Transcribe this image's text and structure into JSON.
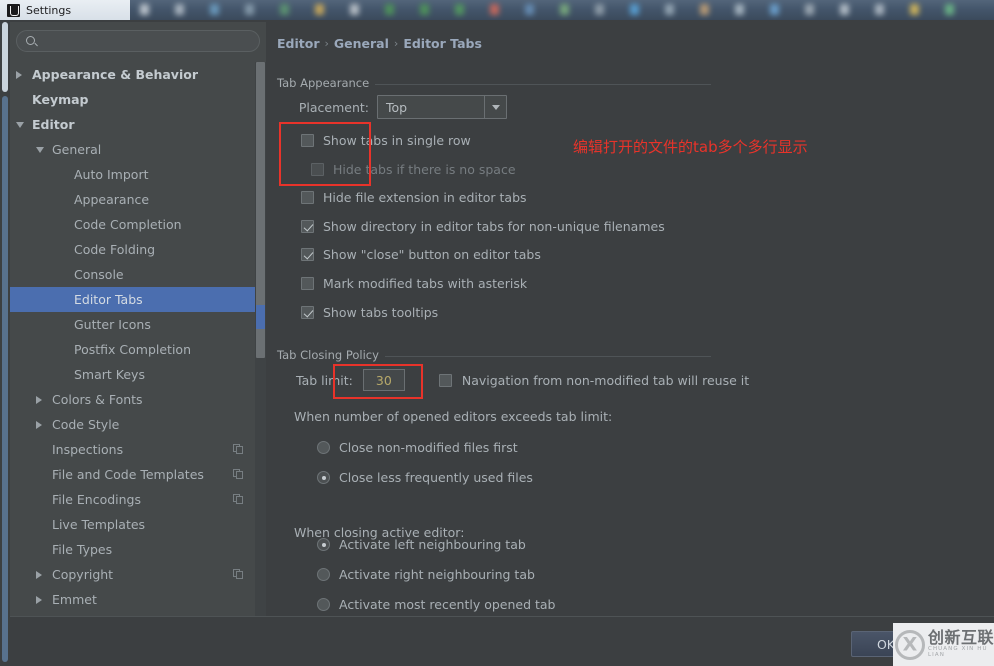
{
  "window": {
    "title": "Settings",
    "logo_icon": "intellij-idea-logo-icon"
  },
  "search": {
    "placeholder": "",
    "value": "",
    "icon": "search-icon"
  },
  "sidebar": {
    "items": [
      {
        "label": "Appearance & Behavior",
        "indent": 0,
        "arrow": "closed",
        "bold": true,
        "selected": false,
        "copy": false
      },
      {
        "label": "Keymap",
        "indent": 0,
        "arrow": "none",
        "bold": true,
        "selected": false,
        "copy": false
      },
      {
        "label": "Editor",
        "indent": 0,
        "arrow": "open",
        "bold": true,
        "selected": false,
        "copy": false
      },
      {
        "label": "General",
        "indent": 1,
        "arrow": "open",
        "bold": false,
        "selected": false,
        "copy": false
      },
      {
        "label": "Auto Import",
        "indent": 2,
        "arrow": "none",
        "bold": false,
        "selected": false,
        "copy": false
      },
      {
        "label": "Appearance",
        "indent": 2,
        "arrow": "none",
        "bold": false,
        "selected": false,
        "copy": false
      },
      {
        "label": "Code Completion",
        "indent": 2,
        "arrow": "none",
        "bold": false,
        "selected": false,
        "copy": false
      },
      {
        "label": "Code Folding",
        "indent": 2,
        "arrow": "none",
        "bold": false,
        "selected": false,
        "copy": false
      },
      {
        "label": "Console",
        "indent": 2,
        "arrow": "none",
        "bold": false,
        "selected": false,
        "copy": false
      },
      {
        "label": "Editor Tabs",
        "indent": 2,
        "arrow": "none",
        "bold": false,
        "selected": true,
        "copy": false
      },
      {
        "label": "Gutter Icons",
        "indent": 2,
        "arrow": "none",
        "bold": false,
        "selected": false,
        "copy": false
      },
      {
        "label": "Postfix Completion",
        "indent": 2,
        "arrow": "none",
        "bold": false,
        "selected": false,
        "copy": false
      },
      {
        "label": "Smart Keys",
        "indent": 2,
        "arrow": "none",
        "bold": false,
        "selected": false,
        "copy": false
      },
      {
        "label": "Colors & Fonts",
        "indent": 1,
        "arrow": "closed",
        "bold": false,
        "selected": false,
        "copy": false
      },
      {
        "label": "Code Style",
        "indent": 1,
        "arrow": "closed",
        "bold": false,
        "selected": false,
        "copy": false
      },
      {
        "label": "Inspections",
        "indent": 1,
        "arrow": "none",
        "bold": false,
        "selected": false,
        "copy": true
      },
      {
        "label": "File and Code Templates",
        "indent": 1,
        "arrow": "none",
        "bold": false,
        "selected": false,
        "copy": true
      },
      {
        "label": "File Encodings",
        "indent": 1,
        "arrow": "none",
        "bold": false,
        "selected": false,
        "copy": true
      },
      {
        "label": "Live Templates",
        "indent": 1,
        "arrow": "none",
        "bold": false,
        "selected": false,
        "copy": false
      },
      {
        "label": "File Types",
        "indent": 1,
        "arrow": "none",
        "bold": false,
        "selected": false,
        "copy": false
      },
      {
        "label": "Copyright",
        "indent": 1,
        "arrow": "closed",
        "bold": false,
        "selected": false,
        "copy": true
      },
      {
        "label": "Emmet",
        "indent": 1,
        "arrow": "closed",
        "bold": false,
        "selected": false,
        "copy": false
      }
    ]
  },
  "breadcrumb": {
    "parts": [
      "Editor",
      "General",
      "Editor Tabs"
    ],
    "separator": "›"
  },
  "tab_appearance": {
    "group_title": "Tab Appearance",
    "placement_label": "Placement:",
    "placement_value": "Top",
    "checkboxes": [
      {
        "label": "Show tabs in single row",
        "checked": false,
        "dimmed": false
      },
      {
        "label": "Hide tabs if there is no space",
        "checked": false,
        "dimmed": true
      },
      {
        "label": "Hide file extension in editor tabs",
        "checked": false,
        "dimmed": false
      },
      {
        "label": "Show directory in editor tabs for non-unique filenames",
        "checked": true,
        "dimmed": false
      },
      {
        "label": "Show \"close\" button on editor tabs",
        "checked": true,
        "dimmed": false
      },
      {
        "label": "Mark modified tabs with asterisk",
        "checked": false,
        "dimmed": false
      },
      {
        "label": "Show tabs tooltips",
        "checked": true,
        "dimmed": false
      }
    ]
  },
  "tab_closing_policy": {
    "group_title": "Tab Closing Policy",
    "tab_limit_label": "Tab limit:",
    "tab_limit_value": "30",
    "reuse_checkbox": {
      "label": "Navigation from non-modified tab will reuse it",
      "checked": false
    },
    "exceeds_label": "When number of opened editors exceeds tab limit:",
    "exceeds_options": [
      {
        "label": "Close non-modified files first",
        "selected": false
      },
      {
        "label": "Close less frequently used files",
        "selected": true
      }
    ],
    "closing_label": "When closing active editor:",
    "closing_options": [
      {
        "label": "Activate left neighbouring tab",
        "selected": true
      },
      {
        "label": "Activate right neighbouring tab",
        "selected": false
      },
      {
        "label": "Activate most recently opened tab",
        "selected": false
      }
    ]
  },
  "annotations": {
    "note_text": "编辑打开的文件的tab多个多行显示",
    "color": "#e8332a"
  },
  "buttons": {
    "ok": "OK"
  },
  "watermark": {
    "cn": "创新互联",
    "en": "CHUANG XIN HU LIAN"
  },
  "colors": {
    "accent_selection": "#4b6eaf",
    "panel_bg": "#3c3f41",
    "tree_bg": "#45494a",
    "annotation_red": "#e8332a"
  }
}
